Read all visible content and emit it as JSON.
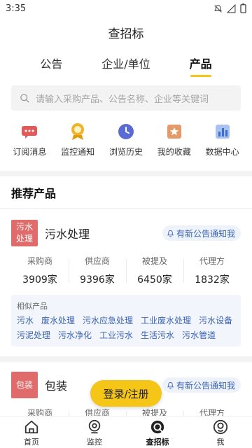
{
  "status_bar": {
    "time": "3:35"
  },
  "page_title": "查招标",
  "tabs": [
    {
      "label": "公告",
      "active": false
    },
    {
      "label": "企业/单位",
      "active": false
    },
    {
      "label": "产品",
      "active": true
    }
  ],
  "search": {
    "placeholder": "请输入采购产品、公告名称、企业等关键词"
  },
  "quick_actions": [
    {
      "label": "订阅消息",
      "icon": "message-icon",
      "color": "#e05a5a"
    },
    {
      "label": "监控通知",
      "icon": "medal-icon",
      "color": "#f0b429"
    },
    {
      "label": "浏览历史",
      "icon": "clock-icon",
      "color": "#5b6bd6"
    },
    {
      "label": "我的收藏",
      "icon": "star-icon",
      "color": "#e59a6a"
    },
    {
      "label": "数据中心",
      "icon": "bar-chart-icon",
      "color": "#5b8de0"
    }
  ],
  "section_title": "推荐产品",
  "products": [
    {
      "badge": "污水处理",
      "name": "污水处理",
      "notify": "有新公告通知我",
      "stats": [
        {
          "label": "采购商",
          "value": "3909家"
        },
        {
          "label": "供应商",
          "value": "9396家"
        },
        {
          "label": "被提及",
          "value": "6450家"
        },
        {
          "label": "代理方",
          "value": "1832家"
        }
      ],
      "similar_title": "相似产品",
      "similar": [
        "污水",
        "废水处理",
        "污水应急处理",
        "工业废水处理",
        "污水设备",
        "污泥处理",
        "污水净化",
        "工业污水",
        "生活污水",
        "污水管道"
      ]
    },
    {
      "badge": "包装",
      "name": "包装",
      "notify": "有新公告通知我",
      "stats": [
        {
          "label": "采购商",
          "value": ""
        },
        {
          "label": "供应商",
          "value": ""
        },
        {
          "label": "被提及",
          "value": ""
        },
        {
          "label": "代理方",
          "value": ""
        }
      ]
    }
  ],
  "login_button": "登录/注册",
  "bottom_nav": [
    {
      "label": "首页",
      "icon": "home-icon",
      "active": false
    },
    {
      "label": "监控",
      "icon": "camera-icon",
      "active": false
    },
    {
      "label": "查招标",
      "icon": "search-bid-icon",
      "active": true
    },
    {
      "label": "我",
      "icon": "profile-icon",
      "active": false
    }
  ]
}
